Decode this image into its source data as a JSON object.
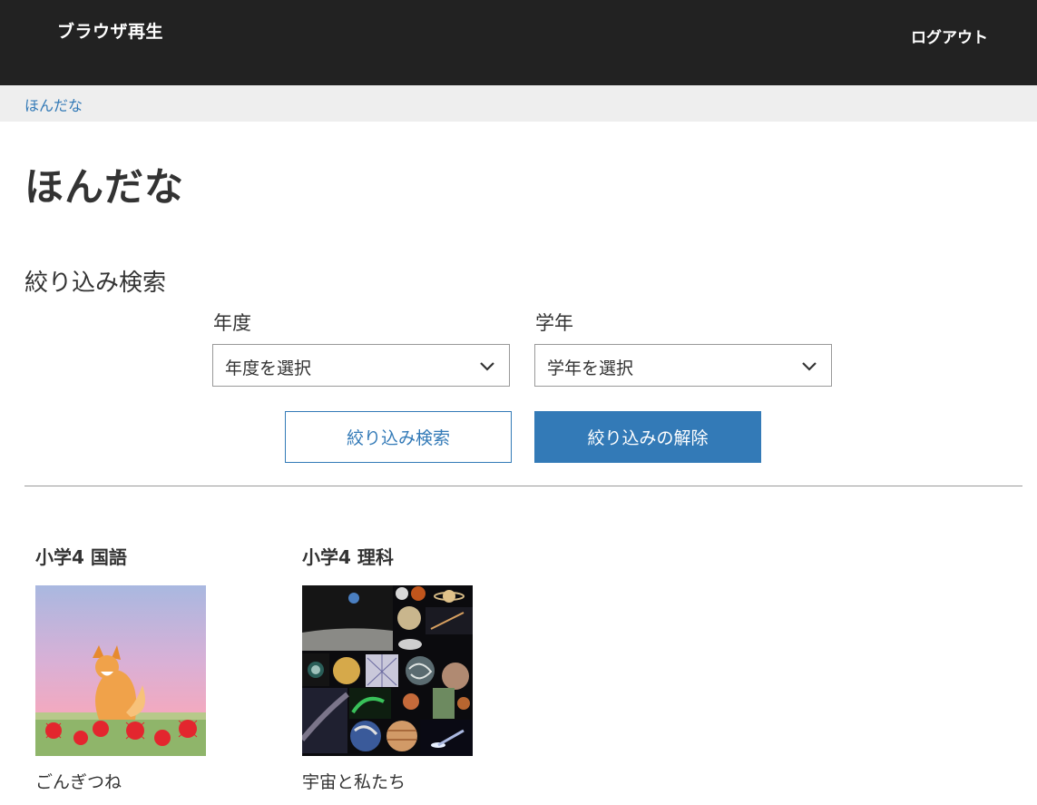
{
  "header": {
    "app_title": "ブラウザ再生",
    "logout_label": "ログアウト"
  },
  "breadcrumb": {
    "current": "ほんだな"
  },
  "page": {
    "title": "ほんだな"
  },
  "filter": {
    "heading": "絞り込み検索",
    "year_label": "年度",
    "year_select_value": "年度を選択",
    "grade_label": "学年",
    "grade_select_value": "学年を選択",
    "search_button": "絞り込み検索",
    "clear_button": "絞り込みの解除"
  },
  "books": [
    {
      "subject": "小学4 国語",
      "title": "ごんぎつね",
      "cover_icon": "fox-illustration"
    },
    {
      "subject": "小学4 理科",
      "title": "宇宙と私たち",
      "cover_icon": "space-collage"
    }
  ],
  "colors": {
    "header_bg": "#222222",
    "accent": "#337ab7",
    "breadcrumb_bg": "#eeeeee"
  }
}
